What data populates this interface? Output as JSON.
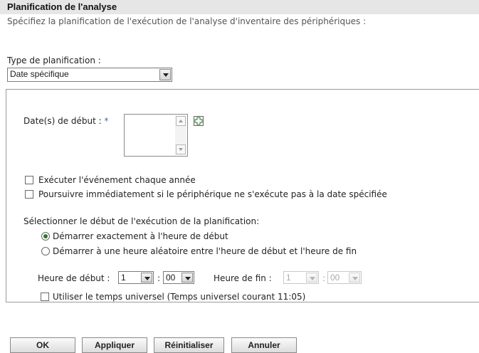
{
  "header": {
    "title": "Planification de l'analyse"
  },
  "description": "Spécifiez la planification de l'exécution de l'analyse d'inventaire des périphériques :",
  "schedule_type": {
    "label": "Type de planification :",
    "value": "Date spécifique"
  },
  "start_dates": {
    "label": "Date(s) de début :",
    "required_mark": "*"
  },
  "options": {
    "yearly": "Exécuter l'événement chaque année",
    "immediate": "Poursuivre immédiatement si le périphérique ne s'exécute pas à la date spécifiée"
  },
  "start_selection": {
    "label": "Sélectionner le début de l'exécution de la planification:",
    "exact": "Démarrer exactement à l'heure de début",
    "random": "Démarrer à une heure aléatoire entre l'heure de début et l'heure de fin",
    "selected": "exact"
  },
  "time": {
    "start_label": "Heure de début :",
    "start_hour": "1",
    "sep": ":",
    "start_min": "00",
    "end_label": "Heure de fin :",
    "end_hour": "1",
    "end_min": "00"
  },
  "utc": {
    "label": "Utiliser le temps universel (Temps universel courant 11:05)"
  },
  "buttons": {
    "ok": "OK",
    "apply": "Appliquer",
    "reset": "Réinitialiser",
    "cancel": "Annuler"
  },
  "colors": {
    "header_bg": "#e6e6e6",
    "required": "#4a6aa8",
    "radio_selected": "#2a7a2a"
  }
}
